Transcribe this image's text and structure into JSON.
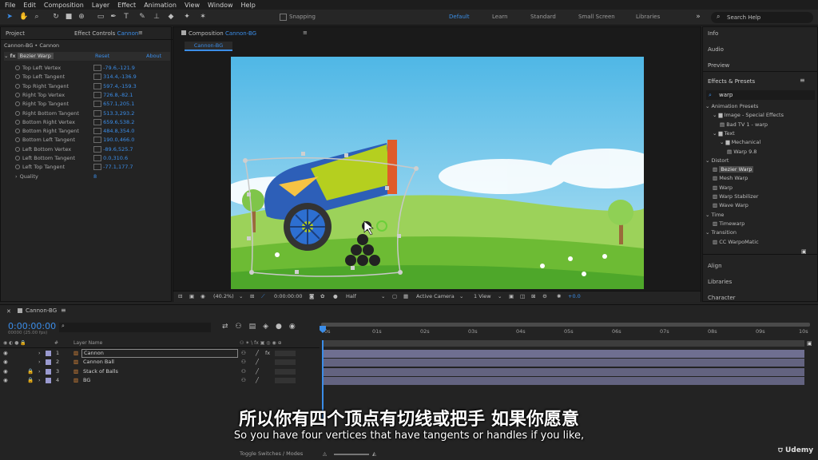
{
  "menu": [
    "File",
    "Edit",
    "Composition",
    "Layer",
    "Effect",
    "Animation",
    "View",
    "Window",
    "Help"
  ],
  "toolbar": {
    "snapping_label": "Snapping",
    "workspaces": [
      "Default",
      "Learn",
      "Standard",
      "Small Screen",
      "Libraries"
    ],
    "search_placeholder": "Search Help"
  },
  "left_panel": {
    "tab_project": "Project",
    "tab_effect_controls": "Effect Controls",
    "tab_effect_controls_target": "Cannon",
    "breadcrumb": "Cannon-BG • Cannon",
    "effect_name": "Bezier Warp",
    "reset_label": "Reset",
    "about_label": "About",
    "params": [
      {
        "label": "Top Left Vertex",
        "value": "-79.6,-121.9"
      },
      {
        "label": "Top Left Tangent",
        "value": "314.4,-136.9"
      },
      {
        "label": "Top Right Tangent",
        "value": "597.4,-159.3"
      },
      {
        "label": "Right Top Vertex",
        "value": "726.8,-82.1"
      },
      {
        "label": "Right Top Tangent",
        "value": "657.1,205.1"
      },
      {
        "label": "Right Bottom Tangent",
        "value": "513.3,293.2"
      },
      {
        "label": "Bottom Right Vertex",
        "value": "659.6,538.2"
      },
      {
        "label": "Bottom Right Tangent",
        "value": "484.8,354.0"
      },
      {
        "label": "Bottom Left Tangent",
        "value": "190.0,466.0"
      },
      {
        "label": "Left Bottom Vertex",
        "value": "-89.6,525.7"
      },
      {
        "label": "Left Bottom Tangent",
        "value": "0.0,310.6"
      },
      {
        "label": "Left Top Tangent",
        "value": "-77.1,177.7"
      },
      {
        "label": "Quality",
        "value": "8"
      }
    ]
  },
  "composition": {
    "tab_label": "Composition",
    "tab_target": "Cannon-BG",
    "sub_tab": "Cannon-BG",
    "footer": {
      "zoom": "(40.2%)",
      "timecode": "0:00:00:00",
      "resolution": "Half",
      "camera": "Active Camera",
      "views": "1 View",
      "exposure": "+0.0"
    }
  },
  "right_panel": {
    "info": "Info",
    "audio": "Audio",
    "preview": "Preview",
    "effects_presets": "Effects & Presets",
    "search_value": "warp",
    "tree": [
      {
        "text": "Animation Presets",
        "indent": 0,
        "type": "folder-open"
      },
      {
        "text": "Image - Special Effects",
        "indent": 1,
        "type": "folder"
      },
      {
        "text": "Bad TV 1 - warp",
        "indent": 2,
        "type": "preset"
      },
      {
        "text": "Text",
        "indent": 1,
        "type": "folder"
      },
      {
        "text": "Mechanical",
        "indent": 2,
        "type": "folder"
      },
      {
        "text": "Warp 9.8",
        "indent": 3,
        "type": "preset"
      },
      {
        "text": "Distort",
        "indent": 0,
        "type": "category"
      },
      {
        "text": "Bezier Warp",
        "indent": 1,
        "type": "effect",
        "selected": true
      },
      {
        "text": "Mesh Warp",
        "indent": 1,
        "type": "effect"
      },
      {
        "text": "Warp",
        "indent": 1,
        "type": "effect"
      },
      {
        "text": "Warp Stabilizer",
        "indent": 1,
        "type": "effect"
      },
      {
        "text": "Wave Warp",
        "indent": 1,
        "type": "effect"
      },
      {
        "text": "Time",
        "indent": 0,
        "type": "category"
      },
      {
        "text": "Timewarp",
        "indent": 1,
        "type": "effect"
      },
      {
        "text": "Transition",
        "indent": 0,
        "type": "category"
      },
      {
        "text": "CC WarpoMatic",
        "indent": 1,
        "type": "effect"
      }
    ],
    "align": "Align",
    "libraries": "Libraries",
    "character": "Character"
  },
  "timeline": {
    "tab_label": "Cannon-BG",
    "timecode": "0:00:00:00",
    "timecode_sub": "00000 (25.00 fps)",
    "col_num": "#",
    "col_layer": "Layer Name",
    "ruler": [
      "0s",
      "01s",
      "02s",
      "03s",
      "04s",
      "05s",
      "06s",
      "07s",
      "08s",
      "09s",
      "10s"
    ],
    "layers": [
      {
        "num": "1",
        "name": "Cannon",
        "selected": true
      },
      {
        "num": "2",
        "name": "Cannon Ball",
        "selected": false
      },
      {
        "num": "3",
        "name": "Stack of Balls",
        "selected": false
      },
      {
        "num": "4",
        "name": "BG",
        "selected": false
      }
    ],
    "toggle_label": "Toggle Switches / Modes"
  },
  "subtitles": {
    "cn": "所以你有四个顶点有切线或把手 如果你愿意",
    "en": "So you have four vertices that have tangents or handles if you like,"
  },
  "watermark": "Udemy",
  "colors": {
    "accent": "#3b8de8",
    "track": "#6f6f91",
    "sky": "#8fd0ec",
    "grass": "#7cc43c"
  }
}
